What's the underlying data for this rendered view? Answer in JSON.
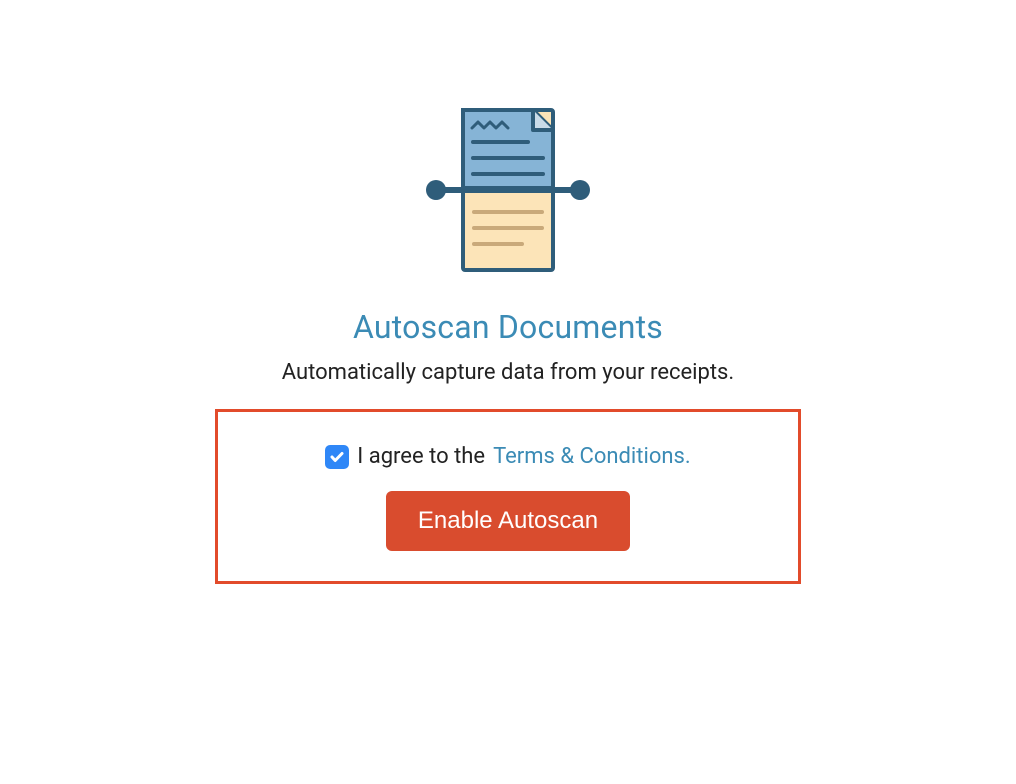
{
  "hero": {
    "title": "Autoscan Documents",
    "subtitle": "Automatically capture data from your receipts."
  },
  "consent": {
    "checked": true,
    "prefix_text": "I agree to the ",
    "link_text": "Terms & Conditions."
  },
  "cta": {
    "enable_label": "Enable Autoscan"
  },
  "colors": {
    "accent_blue": "#3b8bb5",
    "cta_red": "#d94c2e",
    "highlight_border": "#e24b2b",
    "checkbox_blue": "#2f87f7"
  }
}
